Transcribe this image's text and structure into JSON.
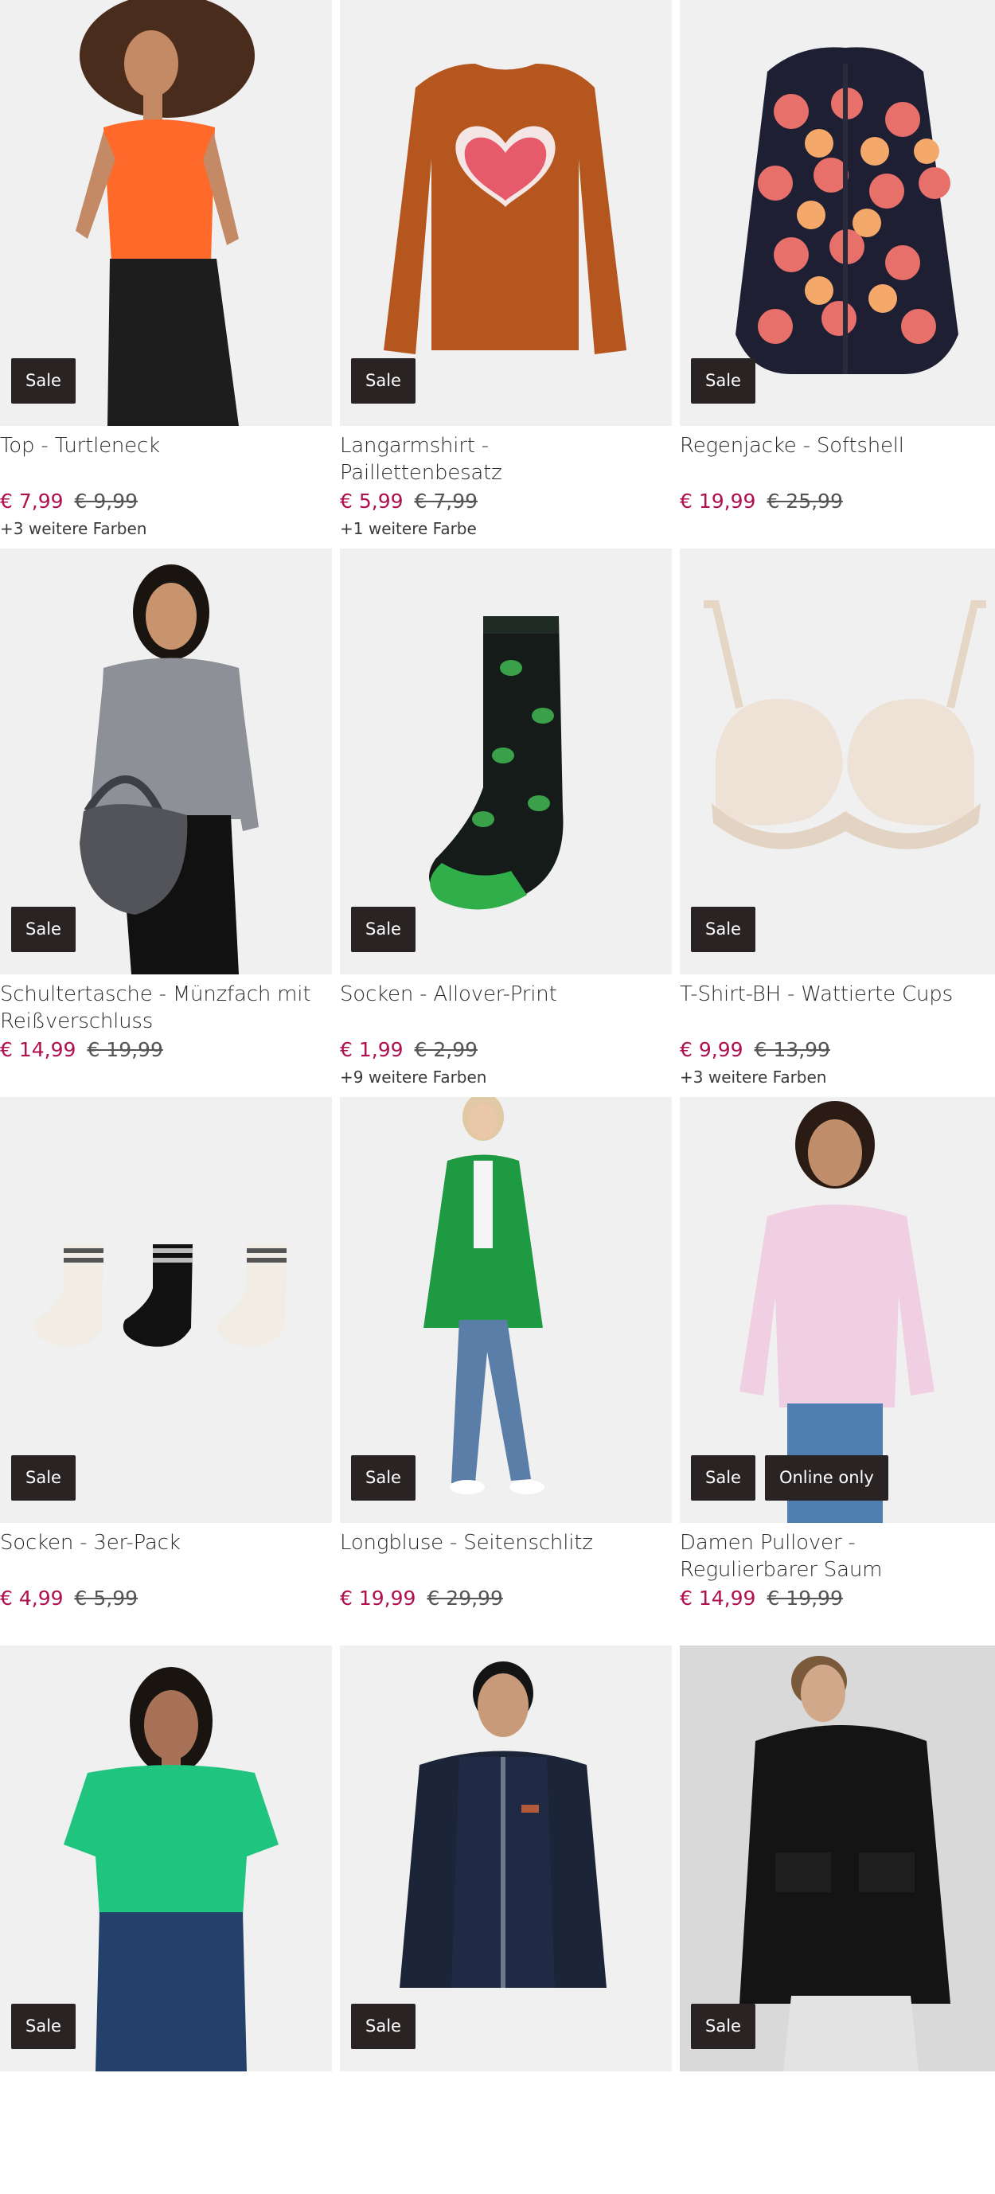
{
  "products": [
    {
      "title": "Top - Turtleneck",
      "price": "€ 7,99",
      "old_price": "€ 9,99",
      "colors": "+3 weitere Farben",
      "badges": [
        "Sale"
      ]
    },
    {
      "title": "Langarmshirt - Paillettenbesatz",
      "price": "€ 5,99",
      "old_price": "€ 7,99",
      "colors": "+1 weitere Farbe",
      "badges": [
        "Sale"
      ]
    },
    {
      "title": "Regenjacke - Softshell",
      "price": "€ 19,99",
      "old_price": "€ 25,99",
      "colors": "",
      "badges": [
        "Sale"
      ]
    },
    {
      "title": "Schultertasche - Münzfach mit Reißverschluss",
      "price": "€ 14,99",
      "old_price": "€ 19,99",
      "colors": "",
      "badges": [
        "Sale"
      ]
    },
    {
      "title": "Socken - Allover-Print",
      "price": "€ 1,99",
      "old_price": "€ 2,99",
      "colors": "+9 weitere Farben",
      "badges": [
        "Sale"
      ]
    },
    {
      "title": "T-Shirt-BH - Wattierte Cups",
      "price": "€ 9,99",
      "old_price": "€ 13,99",
      "colors": "+3 weitere Farben",
      "badges": [
        "Sale"
      ]
    },
    {
      "title": "Socken - 3er-Pack",
      "price": "€ 4,99",
      "old_price": "€ 5,99",
      "colors": "",
      "badges": [
        "Sale"
      ]
    },
    {
      "title": "Longbluse - Seitenschlitz",
      "price": "€ 19,99",
      "old_price": "€ 29,99",
      "colors": "",
      "badges": [
        "Sale"
      ]
    },
    {
      "title": "Damen Pullover - Regulierbarer Saum",
      "price": "€ 14,99",
      "old_price": "€ 19,99",
      "colors": "",
      "badges": [
        "Sale",
        "Online only"
      ]
    },
    {
      "title": "",
      "price": "",
      "old_price": "",
      "colors": "",
      "badges": [
        "Sale"
      ]
    },
    {
      "title": "",
      "price": "",
      "old_price": "",
      "colors": "",
      "badges": [
        "Sale"
      ]
    },
    {
      "title": "",
      "price": "",
      "old_price": "",
      "colors": "",
      "badges": [
        "Sale"
      ]
    }
  ],
  "colors": {
    "sale_price": "#b0104f",
    "badge_bg": "#2a2323",
    "image_bg": "#f0f0f0"
  }
}
